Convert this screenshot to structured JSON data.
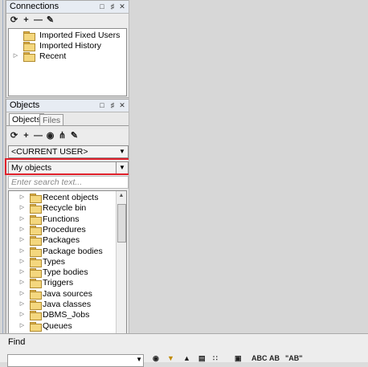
{
  "connections": {
    "title": "Connections",
    "items": [
      {
        "label": "Imported Fixed Users",
        "expandable": false
      },
      {
        "label": "Imported History",
        "expandable": false
      },
      {
        "label": "Recent",
        "expandable": true
      }
    ]
  },
  "objects": {
    "title": "Objects",
    "tabs": [
      {
        "label": "Objects",
        "active": true
      },
      {
        "label": "Files",
        "active": false
      }
    ],
    "user_select": {
      "value": "<CURRENT USER>"
    },
    "filter_select": {
      "value": "My objects"
    },
    "search": {
      "placeholder": "Enter search text..."
    },
    "items": [
      {
        "label": "Recent objects"
      },
      {
        "label": "Recycle bin"
      },
      {
        "label": "Functions"
      },
      {
        "label": "Procedures"
      },
      {
        "label": "Packages"
      },
      {
        "label": "Package bodies"
      },
      {
        "label": "Types"
      },
      {
        "label": "Type bodies"
      },
      {
        "label": "Triggers"
      },
      {
        "label": "Java sources"
      },
      {
        "label": "Java classes"
      },
      {
        "label": "DBMS_Jobs"
      },
      {
        "label": "Queues"
      }
    ]
  },
  "find": {
    "title": "Find"
  },
  "colors": {
    "highlight": "#e0202a",
    "folder": "#f4d77e"
  }
}
